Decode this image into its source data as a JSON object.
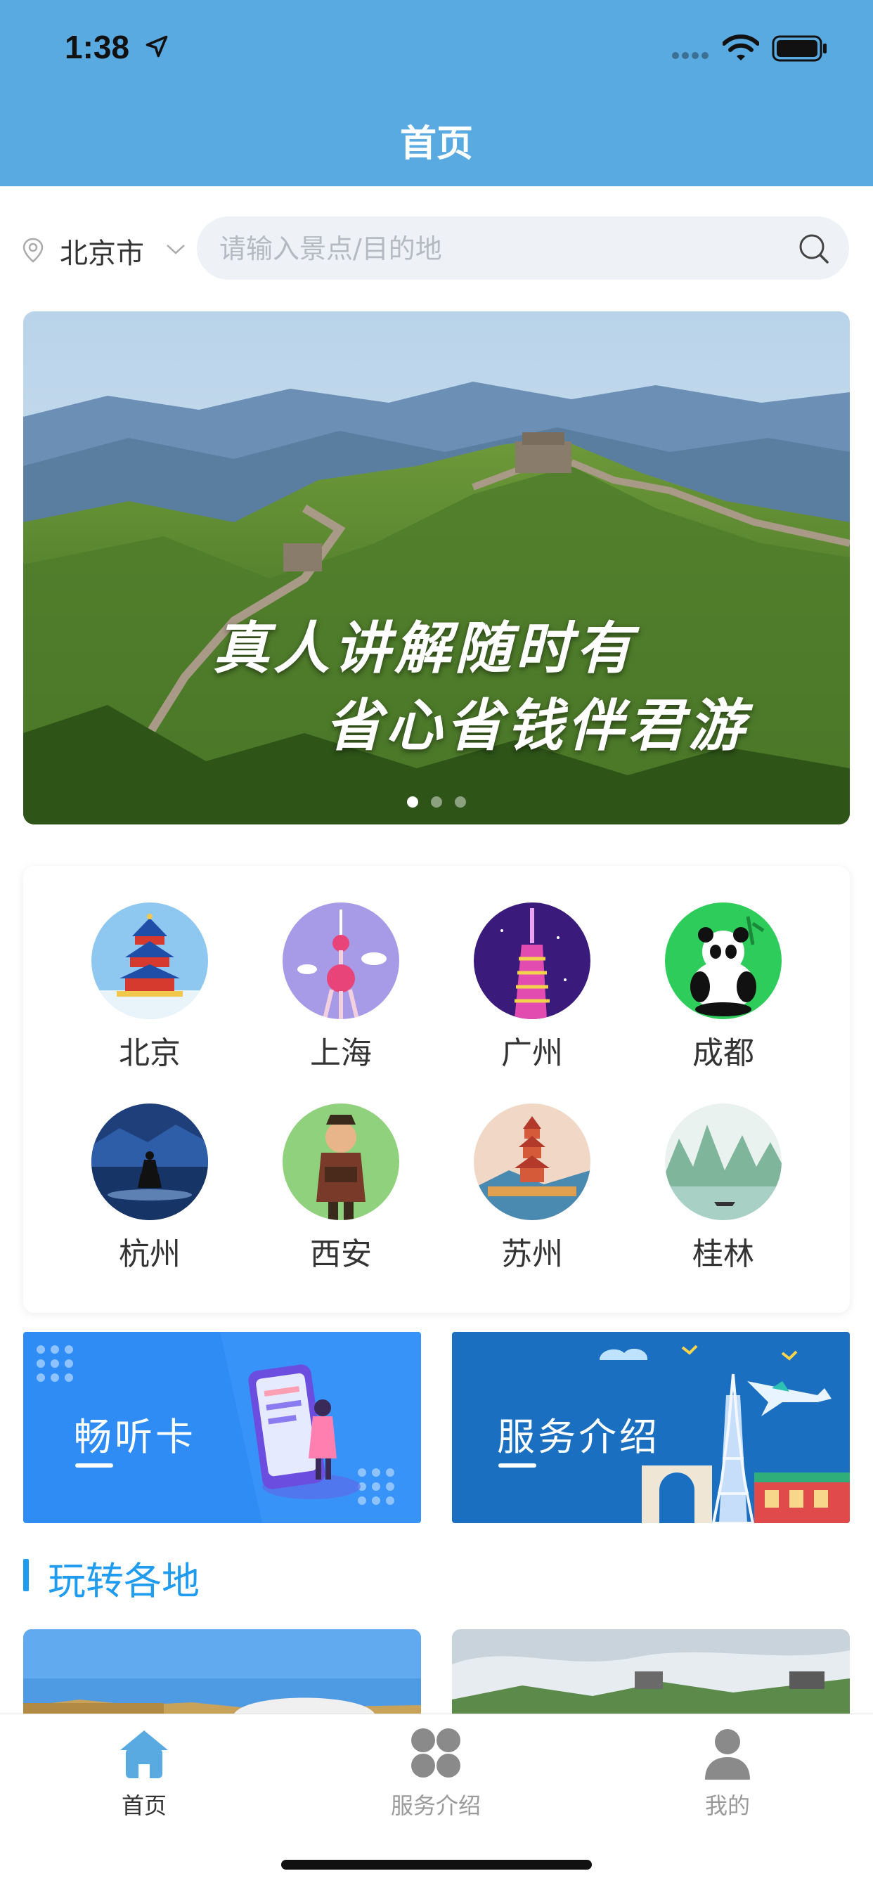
{
  "status_bar": {
    "time": "1:38"
  },
  "header": {
    "title": "首页"
  },
  "location": {
    "city": "北京市"
  },
  "search": {
    "placeholder": "请输入景点/目的地"
  },
  "banner": {
    "slogan_line1": "真人讲解随时有",
    "slogan_line2": "省心省钱伴君游",
    "dots_count": 3,
    "active_dot": 1
  },
  "cities": [
    {
      "name": "北京",
      "icon": "temple-of-heaven-icon"
    },
    {
      "name": "上海",
      "icon": "oriental-pearl-tower-icon"
    },
    {
      "name": "广州",
      "icon": "canton-tower-icon"
    },
    {
      "name": "成都",
      "icon": "panda-icon"
    },
    {
      "name": "杭州",
      "icon": "west-lake-pagoda-icon"
    },
    {
      "name": "西安",
      "icon": "terracotta-warrior-icon"
    },
    {
      "name": "苏州",
      "icon": "suzhou-pagoda-icon"
    },
    {
      "name": "桂林",
      "icon": "guilin-landscape-icon"
    }
  ],
  "promos": {
    "card1": "畅听卡",
    "card2": "服务介绍"
  },
  "section": {
    "title": "玩转各地"
  },
  "tabbar": {
    "home": "首页",
    "services": "服务介绍",
    "mine": "我的"
  },
  "colors": {
    "header_bg": "#5aaae2",
    "accent": "#1f9bf0",
    "tab_active": "#333333",
    "tab_inactive": "#9a9a9a"
  }
}
